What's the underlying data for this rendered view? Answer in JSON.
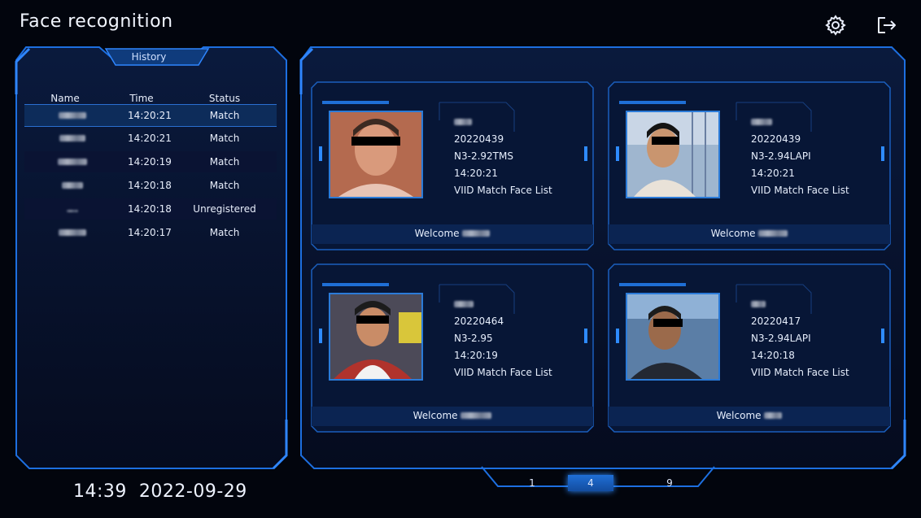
{
  "app": {
    "title": "Face recognition"
  },
  "icons": {
    "settings": "gear-icon",
    "logout": "logout-icon"
  },
  "colors": {
    "background": "#02050d",
    "frame": "#1d6fe0",
    "accent": "#2e8bff",
    "selected_row": "#0d2c5a"
  },
  "history": {
    "tab_label": "History",
    "columns": [
      "Name",
      "Time",
      "Status"
    ],
    "rows": [
      {
        "name": "",
        "time": "14:20:21",
        "status": "Match"
      },
      {
        "name": "",
        "time": "14:20:21",
        "status": "Match"
      },
      {
        "name": "",
        "time": "14:20:19",
        "status": "Match"
      },
      {
        "name": "",
        "time": "14:20:18",
        "status": "Match"
      },
      {
        "name": "",
        "time": "14:20:18",
        "status": "Unregistered"
      },
      {
        "name": "",
        "time": "14:20:17",
        "status": "Match"
      }
    ]
  },
  "cards": [
    {
      "id": "20220439",
      "device": "N3-2.92TMS",
      "time": "14:20:21",
      "list": "VIID Match Face List",
      "welcome": "Welcome"
    },
    {
      "id": "20220439",
      "device": "N3-2.94LAPI",
      "time": "14:20:21",
      "list": "VIID Match Face List",
      "welcome": "Welcome"
    },
    {
      "id": "20220464",
      "device": "N3-2.95",
      "time": "14:20:19",
      "list": "VIID Match Face List",
      "welcome": "Welcome"
    },
    {
      "id": "20220417",
      "device": "N3-2.94LAPI",
      "time": "14:20:18",
      "list": "VIID Match Face List",
      "welcome": "Welcome"
    }
  ],
  "status_bar": {
    "time": "14:39",
    "date": "2022-09-29"
  },
  "pagination": {
    "options": [
      "1",
      "4",
      "9"
    ],
    "selected": "4"
  }
}
